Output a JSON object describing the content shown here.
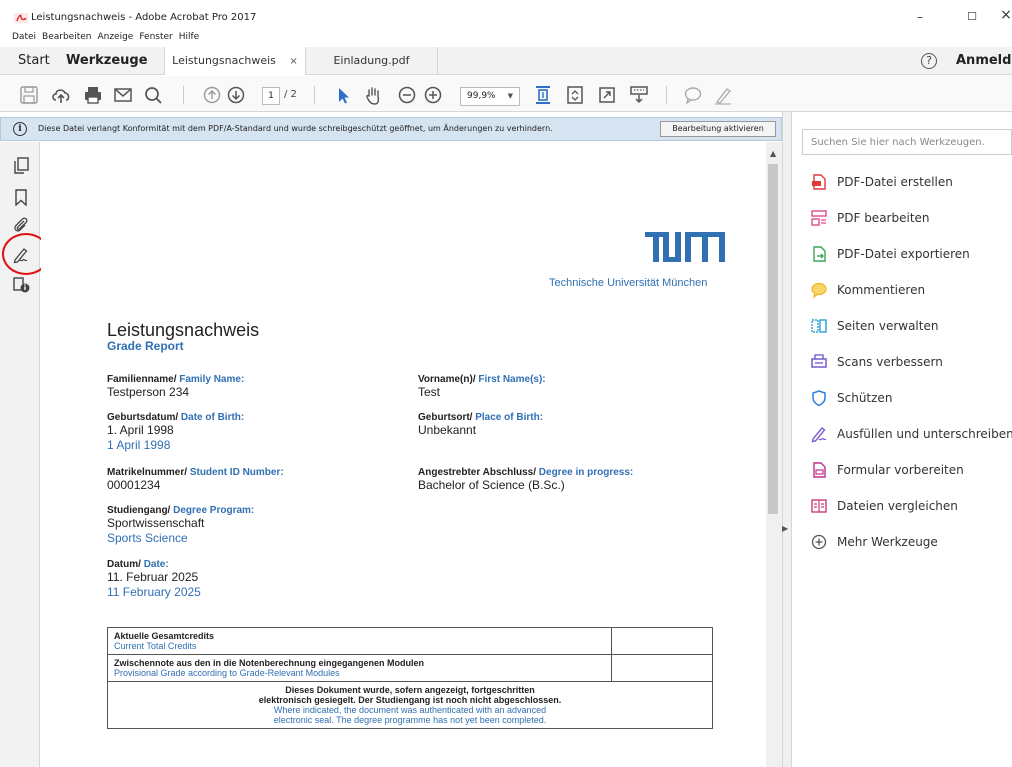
{
  "window": {
    "title": "Leistungsnachweis - Adobe Acrobat Pro 2017",
    "minimize": "–",
    "maximize": "☐",
    "close": "×"
  },
  "menu": [
    "Datei",
    "Bearbeiten",
    "Anzeige",
    "Fenster",
    "Hilfe"
  ],
  "tabs": {
    "start": "Start",
    "tools": "Werkzeuge",
    "documents": [
      {
        "label": "Leistungsnachweis",
        "close": "×",
        "active": true
      },
      {
        "label": "Einladung.pdf",
        "active": false
      }
    ],
    "help": "?",
    "signin": "Anmelden"
  },
  "toolbar": {
    "page_current": "1",
    "page_total": "/ 2",
    "zoom": "99,9%",
    "icons": [
      "save-icon",
      "upload-cloud-icon",
      "print-icon",
      "mail-icon",
      "search-icon",
      "page-up-icon",
      "page-down-icon",
      "select-arrow-icon",
      "hand-icon",
      "zoom-out-icon",
      "zoom-in-icon",
      "fit-page-icon",
      "scroll-mode-icon",
      "full-screen-icon",
      "read-mode-icon",
      "comment-icon",
      "sign-icon"
    ]
  },
  "infobar": {
    "icon": "i",
    "message": "Diese Datei verlangt Konformität mit dem PDF/A-Standard und wurde schreibgeschützt geöffnet, um Änderungen zu verhindern.",
    "button": "Bearbeitung aktivieren"
  },
  "left_rail": [
    "page-thumbnails-icon",
    "bookmark-icon",
    "attachment-icon",
    "signature-icon",
    "security-info-icon"
  ],
  "document": {
    "logo_text": "TUM",
    "university": "Technische Universität München",
    "title": "Leistungsnachweis",
    "subtitle": "Grade Report",
    "fields": {
      "family_name": {
        "label_de": "Familienname/",
        "label_en": "Family Name:",
        "value": "Testperson 234"
      },
      "first_name": {
        "label_de": "Vorname(n)/",
        "label_en": "First Name(s):",
        "value": "Test"
      },
      "birth_date": {
        "label_de": "Geburtsdatum/",
        "label_en": "Date of Birth:",
        "value": "1. April 1998",
        "value_en": "1 April 1998"
      },
      "birth_place": {
        "label_de": "Geburtsort/",
        "label_en": "Place of Birth:",
        "value": "Unbekannt"
      },
      "student_id": {
        "label_de": "Matrikelnummer/",
        "label_en": "Student ID Number:",
        "value": "00001234"
      },
      "degree": {
        "label_de": "Angestrebter Abschluss/",
        "label_en": "Degree in progress:",
        "value": "Bachelor of Science (B.Sc.)"
      },
      "program": {
        "label_de": "Studiengang/",
        "label_en": "Degree Program:",
        "value": "Sportwissenschaft",
        "value_en": "Sports Science"
      },
      "date": {
        "label_de": "Datum/",
        "label_en": "Date:",
        "value": "11. Februar 2025",
        "value_en": "11 February 2025"
      }
    },
    "table": {
      "row1_de": "Aktuelle Gesamtcredits",
      "row1_en": "Current Total Credits",
      "row2_de": "Zwischennote aus den in die Notenberechnung eingegangenen Modulen",
      "row2_en": "Provisional Grade according to Grade-Relevant Modules",
      "note_de_1": "Dieses Dokument wurde, sofern angezeigt, fortgeschritten",
      "note_de_2": "elektronisch gesiegelt. Der Studiengang ist noch nicht abgeschlossen.",
      "note_en_1": "Where indicated, the document was authenticated with an advanced",
      "note_en_2": "electronic seal. The degree programme has not yet been completed."
    }
  },
  "tools_panel": {
    "search_placeholder": "Suchen Sie hier nach Werkzeugen.",
    "items": [
      {
        "label": "PDF-Datei erstellen",
        "icon": "create-pdf-icon",
        "color": "#e03a3a"
      },
      {
        "label": "PDF bearbeiten",
        "icon": "edit-pdf-icon",
        "color": "#e04a8c"
      },
      {
        "label": "PDF-Datei exportieren",
        "icon": "export-pdf-icon",
        "color": "#3aa55a"
      },
      {
        "label": "Kommentieren",
        "icon": "comment-icon",
        "color": "#f2b41e"
      },
      {
        "label": "Seiten verwalten",
        "icon": "organize-pages-icon",
        "color": "#2a9fd6"
      },
      {
        "label": "Scans verbessern",
        "icon": "enhance-scans-icon",
        "color": "#6b4fc9"
      },
      {
        "label": "Schützen",
        "icon": "protect-icon",
        "color": "#2a7fd6"
      },
      {
        "label": "Ausfüllen und unterschreiben",
        "icon": "fill-sign-icon",
        "color": "#7a5cd6"
      },
      {
        "label": "Formular vorbereiten",
        "icon": "prepare-form-icon",
        "color": "#c0308a"
      },
      {
        "label": "Dateien vergleichen",
        "icon": "compare-files-icon",
        "color": "#d03a7a"
      },
      {
        "label": "Mehr Werkzeuge",
        "icon": "more-tools-icon",
        "color": "#555555"
      }
    ]
  }
}
